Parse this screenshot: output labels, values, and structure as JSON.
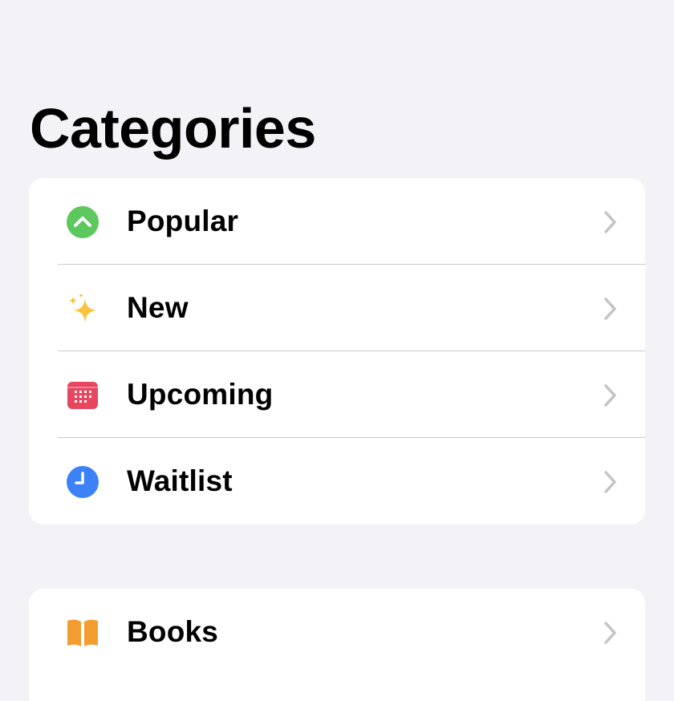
{
  "page": {
    "title": "Categories"
  },
  "groups": [
    {
      "items": [
        {
          "label": "Popular",
          "icon": "arrow-up-circle-icon",
          "color": "#5cc85e"
        },
        {
          "label": "New",
          "icon": "sparkles-icon",
          "color": "#f7c43c"
        },
        {
          "label": "Upcoming",
          "icon": "calendar-icon",
          "color": "#e8455f"
        },
        {
          "label": "Waitlist",
          "icon": "clock-icon",
          "color": "#3c82f6"
        }
      ]
    },
    {
      "items": [
        {
          "label": "Books",
          "icon": "book-icon",
          "color": "#f39c2f"
        }
      ]
    }
  ],
  "colors": {
    "background": "#f2f2f7",
    "card": "#ffffff",
    "chevron": "#c4c4c8",
    "divider": "#c8c8cc"
  }
}
